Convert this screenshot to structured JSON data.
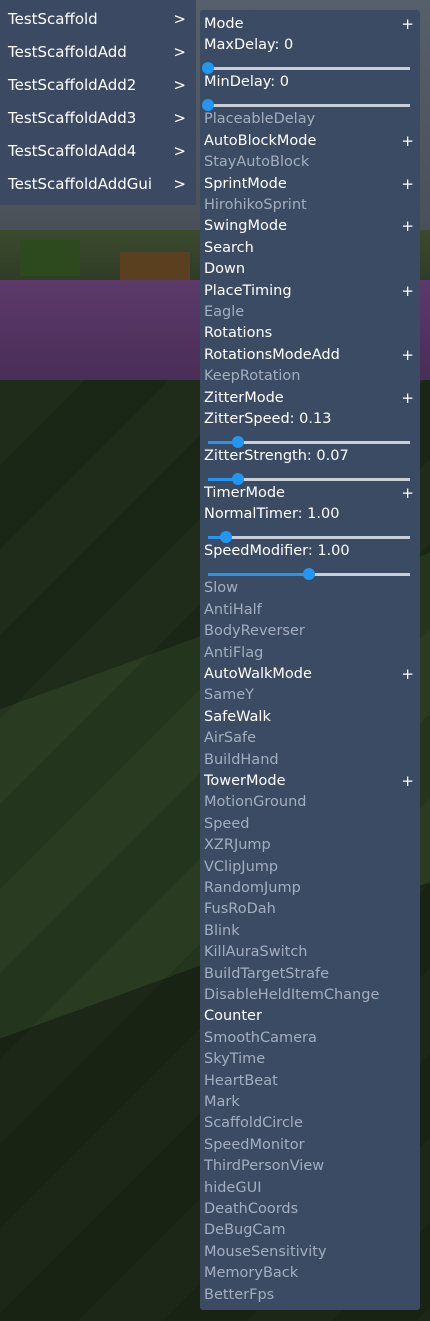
{
  "categories": [
    {
      "label": "TestScaffold",
      "arrow": ">"
    },
    {
      "label": "TestScaffoldAdd",
      "arrow": ">"
    },
    {
      "label": "TestScaffoldAdd2",
      "arrow": ">"
    },
    {
      "label": "TestScaffoldAdd3",
      "arrow": ">"
    },
    {
      "label": "TestScaffoldAdd4",
      "arrow": ">"
    },
    {
      "label": "TestScaffoldAddGui",
      "arrow": ">"
    }
  ],
  "settings": [
    {
      "label": "Mode",
      "type": "mode",
      "plus": "+"
    },
    {
      "label": "MaxDelay: 0",
      "type": "slider",
      "fraction": 0
    },
    {
      "label": "MinDelay: 0",
      "type": "slider",
      "fraction": 0
    },
    {
      "label": "PlaceableDelay",
      "type": "toggle",
      "enabled": false
    },
    {
      "label": "AutoBlockMode",
      "type": "mode",
      "plus": "+"
    },
    {
      "label": "StayAutoBlock",
      "type": "toggle",
      "enabled": false
    },
    {
      "label": "SprintMode",
      "type": "mode",
      "plus": "+"
    },
    {
      "label": "HirohikoSprint",
      "type": "toggle",
      "enabled": false
    },
    {
      "label": "SwingMode",
      "type": "mode",
      "plus": "+"
    },
    {
      "label": "Search",
      "type": "toggle",
      "enabled": true
    },
    {
      "label": "Down",
      "type": "toggle",
      "enabled": true
    },
    {
      "label": "PlaceTiming",
      "type": "mode",
      "plus": "+"
    },
    {
      "label": "Eagle",
      "type": "toggle",
      "enabled": false
    },
    {
      "label": "Rotations",
      "type": "toggle",
      "enabled": true
    },
    {
      "label": "RotationsModeAdd",
      "type": "mode",
      "plus": "+"
    },
    {
      "label": "KeepRotation",
      "type": "toggle",
      "enabled": false
    },
    {
      "label": "ZitterMode",
      "type": "mode",
      "plus": "+"
    },
    {
      "label": "ZitterSpeed: 0.13",
      "type": "slider",
      "fraction": 0.15
    },
    {
      "label": "ZitterStrength: 0.07",
      "type": "slider",
      "fraction": 0.15
    },
    {
      "label": "TimerMode",
      "type": "mode",
      "plus": "+"
    },
    {
      "label": "NormalTimer: 1.00",
      "type": "slider",
      "fraction": 0.09
    },
    {
      "label": "SpeedModifier: 1.00",
      "type": "slider",
      "fraction": 0.5
    },
    {
      "label": "Slow",
      "type": "toggle",
      "enabled": false
    },
    {
      "label": "AntiHalf",
      "type": "toggle",
      "enabled": false
    },
    {
      "label": "BodyReverser",
      "type": "toggle",
      "enabled": false
    },
    {
      "label": "AntiFlag",
      "type": "toggle",
      "enabled": false
    },
    {
      "label": "AutoWalkMode",
      "type": "mode",
      "plus": "+"
    },
    {
      "label": "SameY",
      "type": "toggle",
      "enabled": false
    },
    {
      "label": "SafeWalk",
      "type": "toggle",
      "enabled": true
    },
    {
      "label": "AirSafe",
      "type": "toggle",
      "enabled": false
    },
    {
      "label": "BuildHand",
      "type": "toggle",
      "enabled": false
    },
    {
      "label": "TowerMode",
      "type": "mode",
      "plus": "+"
    },
    {
      "label": "MotionGround",
      "type": "toggle",
      "enabled": false
    },
    {
      "label": "Speed",
      "type": "toggle",
      "enabled": false
    },
    {
      "label": "XZRJump",
      "type": "toggle",
      "enabled": false
    },
    {
      "label": "VClipJump",
      "type": "toggle",
      "enabled": false
    },
    {
      "label": "RandomJump",
      "type": "toggle",
      "enabled": false
    },
    {
      "label": "FusRoDah",
      "type": "toggle",
      "enabled": false
    },
    {
      "label": "Blink",
      "type": "toggle",
      "enabled": false
    },
    {
      "label": "KillAuraSwitch",
      "type": "toggle",
      "enabled": false
    },
    {
      "label": "BuildTargetStrafe",
      "type": "toggle",
      "enabled": false
    },
    {
      "label": "DisableHeldItemChange",
      "type": "toggle",
      "enabled": false
    },
    {
      "label": "Counter",
      "type": "toggle",
      "enabled": true
    },
    {
      "label": "SmoothCamera",
      "type": "toggle",
      "enabled": false
    },
    {
      "label": "SkyTime",
      "type": "toggle",
      "enabled": false
    },
    {
      "label": "HeartBeat",
      "type": "toggle",
      "enabled": false
    },
    {
      "label": "Mark",
      "type": "toggle",
      "enabled": false
    },
    {
      "label": "ScaffoldCircle",
      "type": "toggle",
      "enabled": false
    },
    {
      "label": "SpeedMonitor",
      "type": "toggle",
      "enabled": false
    },
    {
      "label": "ThirdPersonView",
      "type": "toggle",
      "enabled": false
    },
    {
      "label": "hideGUI",
      "type": "toggle",
      "enabled": false
    },
    {
      "label": "DeathCoords",
      "type": "toggle",
      "enabled": false
    },
    {
      "label": "DeBugCam",
      "type": "toggle",
      "enabled": false
    },
    {
      "label": "MouseSensitivity",
      "type": "toggle",
      "enabled": false
    },
    {
      "label": "MemoryBack",
      "type": "toggle",
      "enabled": false
    },
    {
      "label": "BetterFps",
      "type": "toggle",
      "enabled": false
    }
  ],
  "colors": {
    "panel": "#3a4b63",
    "enabled_text": "#ffffff",
    "disabled_text": "#a3afc0",
    "slider_accent": "#2196f3"
  }
}
